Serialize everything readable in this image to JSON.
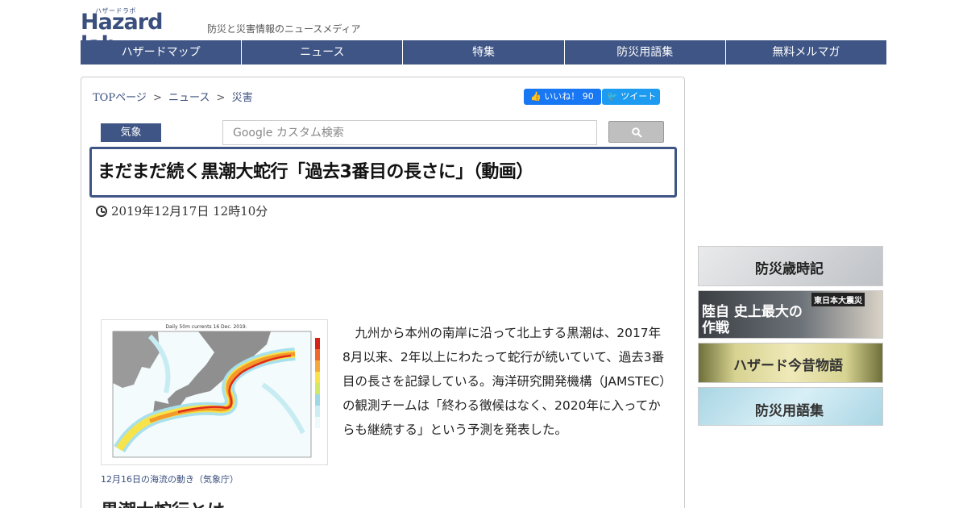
{
  "header": {
    "logo_sub": "ハザードラボ",
    "logo_main": "Hazard lab",
    "tagline": "防災と災害情報のニュースメディア"
  },
  "nav": {
    "items": [
      {
        "label": "ハザードマップ"
      },
      {
        "label": "ニュース"
      },
      {
        "label": "特集"
      },
      {
        "label": "防災用語集"
      },
      {
        "label": "無料メルマガ"
      }
    ]
  },
  "breadcrumb": {
    "items": [
      "TOPページ",
      "ニュース",
      "災害"
    ],
    "separator": ">"
  },
  "social": {
    "like_label": "いいね！ 90",
    "tweet_label": "ツイート"
  },
  "category": "気象",
  "search": {
    "placeholder": "Google カスタム検索"
  },
  "article": {
    "title": "まだまだ続く黒潮大蛇行「過去3番目の長さに」（動画）",
    "date": "2019年12月17日 12時10分",
    "figure_title": "Daily 50m currents 16 Dec. 2019.",
    "figure_caption": "12月16日の海流の動き（気象庁）",
    "body": "九州から本州の南岸に沿って北上する黒潮は、2017年8月以来、2年以上にわたって蛇行が続いていて、過去3番目の長さを記録している。海洋研究開発機構（JAMSTEC）の観測チームは「終わる徴候はなく、2020年に入ってからも継続する」という予測を発表した。",
    "subhead": "黒潮大蛇行とは"
  },
  "sidebar": {
    "banners": [
      {
        "label": "防災歳時記"
      },
      {
        "label_top": "東日本大震災",
        "label_main": "陸自 史上最大の作戦"
      },
      {
        "label": "ハザード今昔物語"
      },
      {
        "label": "防災用語集"
      }
    ]
  },
  "colors": {
    "brand": "#3f5585",
    "facebook": "#1877f2",
    "twitter": "#1d9bf0"
  }
}
